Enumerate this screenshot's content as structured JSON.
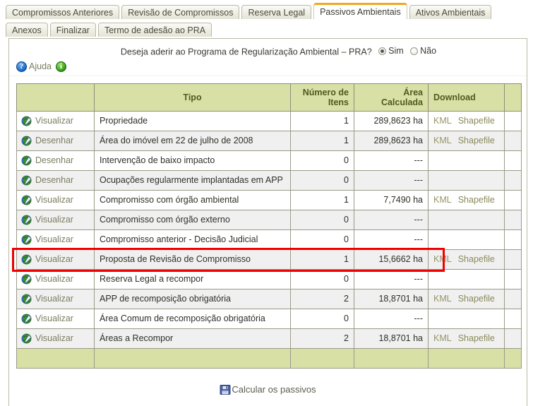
{
  "tabs": {
    "row1": [
      {
        "label": "Compromissos Anteriores",
        "active": false
      },
      {
        "label": "Revisão de Compromissos",
        "active": false
      },
      {
        "label": "Reserva Legal",
        "active": false
      },
      {
        "label": "Passivos Ambientais",
        "active": true
      },
      {
        "label": "Ativos Ambientais",
        "active": false
      }
    ],
    "row2": [
      {
        "label": "Anexos",
        "active": false
      },
      {
        "label": "Finalizar",
        "active": false
      },
      {
        "label": "Termo de adesão ao PRA",
        "active": false
      }
    ]
  },
  "pra": {
    "question": "Deseja aderir ao Programa de Regularização Ambiental – PRA?",
    "option_yes": "Sim",
    "option_no": "Não",
    "selected": "Sim"
  },
  "help": {
    "help_label": "Ajuda",
    "help_icon": "question-circle-icon",
    "info_icon": "info-circle-icon",
    "help_glyph": "?",
    "info_glyph": "i"
  },
  "table": {
    "headers": {
      "action": "",
      "tipo": "Tipo",
      "numero": "Número de Itens",
      "area": "Área Calculada",
      "download": "Download",
      "last": ""
    },
    "rows": [
      {
        "action": "Visualizar",
        "tipo": "Propriedade",
        "numero": "1",
        "area": "289,8623 ha",
        "kml": "KML",
        "shapefile": "Shapefile",
        "highlighted": false
      },
      {
        "action": "Desenhar",
        "tipo": "Área do imóvel em 22 de julho de 2008",
        "numero": "1",
        "area": "289,8623 ha",
        "kml": "KML",
        "shapefile": "Shapefile",
        "highlighted": false
      },
      {
        "action": "Desenhar",
        "tipo": "Intervenção de baixo impacto",
        "numero": "0",
        "area": "---",
        "kml": "",
        "shapefile": "",
        "highlighted": false
      },
      {
        "action": "Desenhar",
        "tipo": "Ocupações regularmente implantadas em APP",
        "numero": "0",
        "area": "---",
        "kml": "",
        "shapefile": "",
        "highlighted": false
      },
      {
        "action": "Visualizar",
        "tipo": "Compromisso com órgão ambiental",
        "numero": "1",
        "area": "7,7490 ha",
        "kml": "KML",
        "shapefile": "Shapefile",
        "highlighted": false
      },
      {
        "action": "Visualizar",
        "tipo": "Compromisso com órgão externo",
        "numero": "0",
        "area": "---",
        "kml": "",
        "shapefile": "",
        "highlighted": false
      },
      {
        "action": "Visualizar",
        "tipo": "Compromisso anterior - Decisão Judicial",
        "numero": "0",
        "area": "---",
        "kml": "",
        "shapefile": "",
        "highlighted": false
      },
      {
        "action": "Visualizar",
        "tipo": "Proposta de Revisão de Compromisso",
        "numero": "1",
        "area": "15,6662 ha",
        "kml": "KML",
        "shapefile": "Shapefile",
        "highlighted": true
      },
      {
        "action": "Visualizar",
        "tipo": "Reserva Legal a recompor",
        "numero": "0",
        "area": "---",
        "kml": "",
        "shapefile": "",
        "highlighted": false
      },
      {
        "action": "Visualizar",
        "tipo": "APP de recomposição obrigatória",
        "numero": "2",
        "area": "18,8701 ha",
        "kml": "KML",
        "shapefile": "Shapefile",
        "highlighted": false
      },
      {
        "action": "Visualizar",
        "tipo": "Área Comum de recomposição obrigatória",
        "numero": "0",
        "area": "---",
        "kml": "",
        "shapefile": "",
        "highlighted": false
      },
      {
        "action": "Visualizar",
        "tipo": "Áreas a Recompor",
        "numero": "2",
        "area": "18,8701 ha",
        "kml": "KML",
        "shapefile": "Shapefile",
        "highlighted": false
      }
    ]
  },
  "footer": {
    "calc_label": "Calcular os passivos",
    "calc_icon": "save-floppy-icon"
  },
  "colors": {
    "tab_active_top": "#f0a81e",
    "table_header_bg": "#d9e0a6",
    "highlight": "#f00000",
    "link": "#8a8a5c"
  }
}
